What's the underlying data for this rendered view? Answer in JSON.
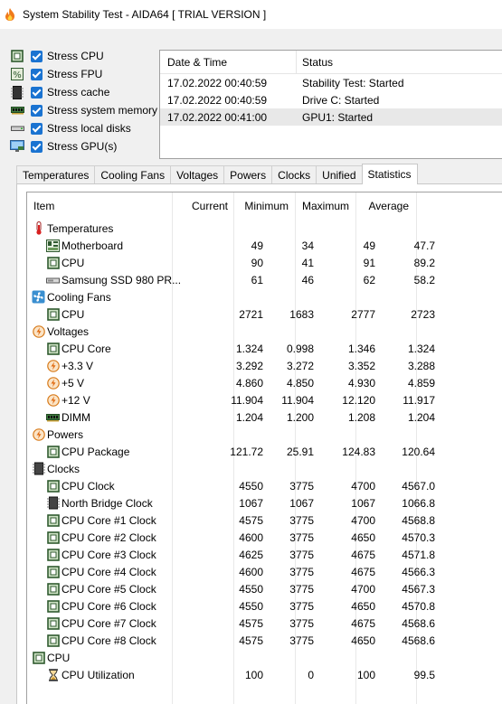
{
  "window": {
    "title": "System Stability Test - AIDA64  [ TRIAL VERSION ]"
  },
  "stress": [
    {
      "label": "Stress CPU",
      "icon": "cpu-chip-icon",
      "checked": true
    },
    {
      "label": "Stress FPU",
      "icon": "fpu-percent-icon",
      "checked": true
    },
    {
      "label": "Stress cache",
      "icon": "cache-icon",
      "checked": true
    },
    {
      "label": "Stress system memory",
      "icon": "memory-module-icon",
      "checked": true
    },
    {
      "label": "Stress local disks",
      "icon": "disk-drive-icon",
      "checked": true
    },
    {
      "label": "Stress GPU(s)",
      "icon": "monitor-icon",
      "checked": true
    }
  ],
  "log": {
    "headers": {
      "datetime": "Date & Time",
      "status": "Status"
    },
    "rows": [
      {
        "datetime": "17.02.2022 00:40:59",
        "status": "Stability Test: Started"
      },
      {
        "datetime": "17.02.2022 00:40:59",
        "status": "Drive C: Started"
      },
      {
        "datetime": "17.02.2022 00:41:00",
        "status": "GPU1: Started"
      }
    ]
  },
  "tabs": [
    "Temperatures",
    "Cooling Fans",
    "Voltages",
    "Powers",
    "Clocks",
    "Unified",
    "Statistics"
  ],
  "active_tab": "Statistics",
  "stats": {
    "headers": {
      "item": "Item",
      "current": "Current",
      "minimum": "Minimum",
      "maximum": "Maximum",
      "average": "Average"
    },
    "rows": [
      {
        "kind": "cat",
        "name": "Temperatures",
        "icon": "thermometer-icon"
      },
      {
        "kind": "item",
        "name": "Motherboard",
        "icon": "motherboard-icon",
        "cur": "49",
        "min": "34",
        "max": "49",
        "avg": "47.7"
      },
      {
        "kind": "item",
        "name": "CPU",
        "icon": "cpu-chip-icon",
        "cur": "90",
        "min": "41",
        "max": "91",
        "avg": "89.2"
      },
      {
        "kind": "item",
        "name": "Samsung SSD 980 PR...",
        "icon": "ssd-icon",
        "cur": "61",
        "min": "46",
        "max": "62",
        "avg": "58.2"
      },
      {
        "kind": "cat",
        "name": "Cooling Fans",
        "icon": "fan-icon"
      },
      {
        "kind": "item",
        "name": "CPU",
        "icon": "cpu-chip-icon",
        "cur": "2721",
        "min": "1683",
        "max": "2777",
        "avg": "2723"
      },
      {
        "kind": "cat",
        "name": "Voltages",
        "icon": "voltage-bolt-icon"
      },
      {
        "kind": "item",
        "name": "CPU Core",
        "icon": "cpu-chip-icon",
        "cur": "1.324",
        "min": "0.998",
        "max": "1.346",
        "avg": "1.324"
      },
      {
        "kind": "item",
        "name": "+3.3 V",
        "icon": "voltage-bolt-icon",
        "cur": "3.292",
        "min": "3.272",
        "max": "3.352",
        "avg": "3.288"
      },
      {
        "kind": "item",
        "name": "+5 V",
        "icon": "voltage-bolt-icon",
        "cur": "4.860",
        "min": "4.850",
        "max": "4.930",
        "avg": "4.859"
      },
      {
        "kind": "item",
        "name": "+12 V",
        "icon": "voltage-bolt-icon",
        "cur": "11.904",
        "min": "11.904",
        "max": "12.120",
        "avg": "11.917"
      },
      {
        "kind": "item",
        "name": "DIMM",
        "icon": "memory-module-icon",
        "cur": "1.204",
        "min": "1.200",
        "max": "1.208",
        "avg": "1.204"
      },
      {
        "kind": "cat",
        "name": "Powers",
        "icon": "voltage-bolt-icon"
      },
      {
        "kind": "item",
        "name": "CPU Package",
        "icon": "cpu-chip-icon",
        "cur": "121.72",
        "min": "25.91",
        "max": "124.83",
        "avg": "120.64"
      },
      {
        "kind": "cat",
        "name": "Clocks",
        "icon": "clock-chip-icon"
      },
      {
        "kind": "item",
        "name": "CPU Clock",
        "icon": "cpu-chip-icon",
        "cur": "4550",
        "min": "3775",
        "max": "4700",
        "avg": "4567.0"
      },
      {
        "kind": "item",
        "name": "North Bridge Clock",
        "icon": "clock-chip-icon",
        "cur": "1067",
        "min": "1067",
        "max": "1067",
        "avg": "1066.8"
      },
      {
        "kind": "item",
        "name": "CPU Core #1 Clock",
        "icon": "cpu-chip-icon",
        "cur": "4575",
        "min": "3775",
        "max": "4700",
        "avg": "4568.8"
      },
      {
        "kind": "item",
        "name": "CPU Core #2 Clock",
        "icon": "cpu-chip-icon",
        "cur": "4600",
        "min": "3775",
        "max": "4650",
        "avg": "4570.3"
      },
      {
        "kind": "item",
        "name": "CPU Core #3 Clock",
        "icon": "cpu-chip-icon",
        "cur": "4625",
        "min": "3775",
        "max": "4675",
        "avg": "4571.8"
      },
      {
        "kind": "item",
        "name": "CPU Core #4 Clock",
        "icon": "cpu-chip-icon",
        "cur": "4600",
        "min": "3775",
        "max": "4675",
        "avg": "4566.3"
      },
      {
        "kind": "item",
        "name": "CPU Core #5 Clock",
        "icon": "cpu-chip-icon",
        "cur": "4550",
        "min": "3775",
        "max": "4700",
        "avg": "4567.3"
      },
      {
        "kind": "item",
        "name": "CPU Core #6 Clock",
        "icon": "cpu-chip-icon",
        "cur": "4550",
        "min": "3775",
        "max": "4650",
        "avg": "4570.8"
      },
      {
        "kind": "item",
        "name": "CPU Core #7 Clock",
        "icon": "cpu-chip-icon",
        "cur": "4575",
        "min": "3775",
        "max": "4675",
        "avg": "4568.6"
      },
      {
        "kind": "item",
        "name": "CPU Core #8 Clock",
        "icon": "cpu-chip-icon",
        "cur": "4575",
        "min": "3775",
        "max": "4650",
        "avg": "4568.6"
      },
      {
        "kind": "cat",
        "name": "CPU",
        "icon": "cpu-chip-icon"
      },
      {
        "kind": "item",
        "name": "CPU Utilization",
        "icon": "hourglass-icon",
        "cur": "100",
        "min": "0",
        "max": "100",
        "avg": "99.5"
      }
    ]
  },
  "colors": {
    "checkbox": "#1a73d1",
    "selected_row": "#e8e8e8",
    "bolt": "#f2a23a"
  }
}
